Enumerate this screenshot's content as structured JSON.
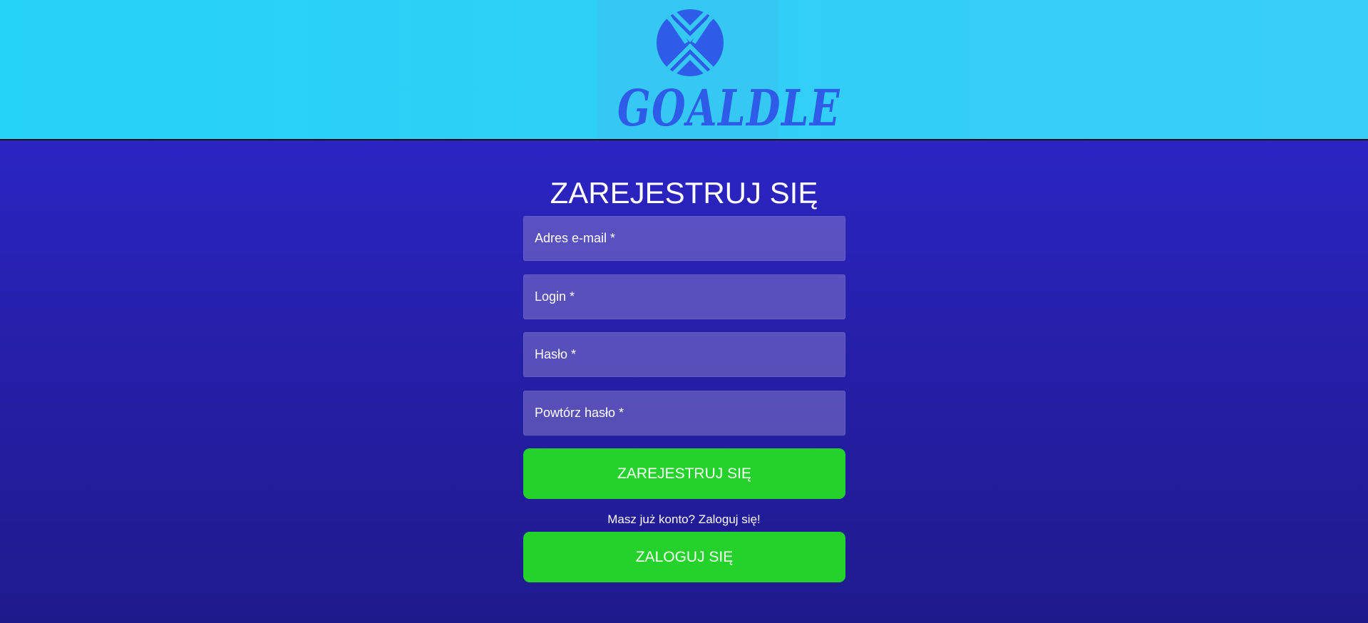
{
  "header": {
    "logo_text": "GOALDLE",
    "logo_color": "#2e5be8"
  },
  "form": {
    "title": "ZAREJESTRUJ SIĘ",
    "fields": [
      {
        "placeholder": "Adres e-mail *"
      },
      {
        "placeholder": "Login *"
      },
      {
        "placeholder": "Hasło *"
      },
      {
        "placeholder": "Powtórz hasło *"
      }
    ],
    "register_label": "ZAREJESTRUJ SIĘ",
    "login_prompt": "Masz już konto? Zaloguj się!",
    "login_label": "ZALOGUJ SIĘ"
  },
  "colors": {
    "button": "#24d22b",
    "header_bg": "#30cff7",
    "page_bg": "#2620ad"
  }
}
